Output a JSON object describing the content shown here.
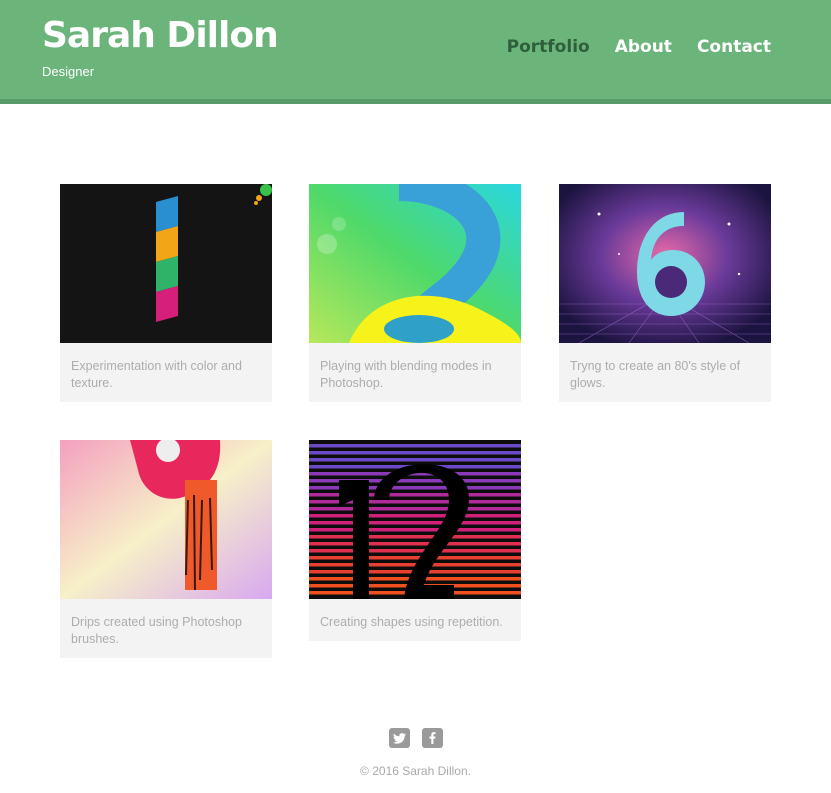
{
  "header": {
    "name": "Sarah Dillon",
    "subtitle": "Designer",
    "nav": [
      {
        "label": "Portfolio",
        "active": true
      },
      {
        "label": "About",
        "active": false
      },
      {
        "label": "Contact",
        "active": false
      }
    ]
  },
  "projects": [
    {
      "caption": "Experimentation with color and texture.",
      "art": "number-1"
    },
    {
      "caption": "Playing with blending modes in Photoshop.",
      "art": "number-2"
    },
    {
      "caption": "Tryng to create an 80's style of glows.",
      "art": "number-6"
    },
    {
      "caption": "Drips created using Photoshop brushes.",
      "art": "number-9"
    },
    {
      "caption": "Creating shapes using repetition.",
      "art": "number-12"
    }
  ],
  "footer": {
    "social": [
      {
        "icon": "twitter-icon",
        "glyph": "t"
      },
      {
        "icon": "facebook-icon",
        "glyph": "f"
      }
    ],
    "copyright": "© 2016 Sarah Dillon."
  },
  "colors": {
    "header": "#6bb57b",
    "active_nav": "#2f5e3a",
    "caption_bg": "#f3f3f3"
  }
}
